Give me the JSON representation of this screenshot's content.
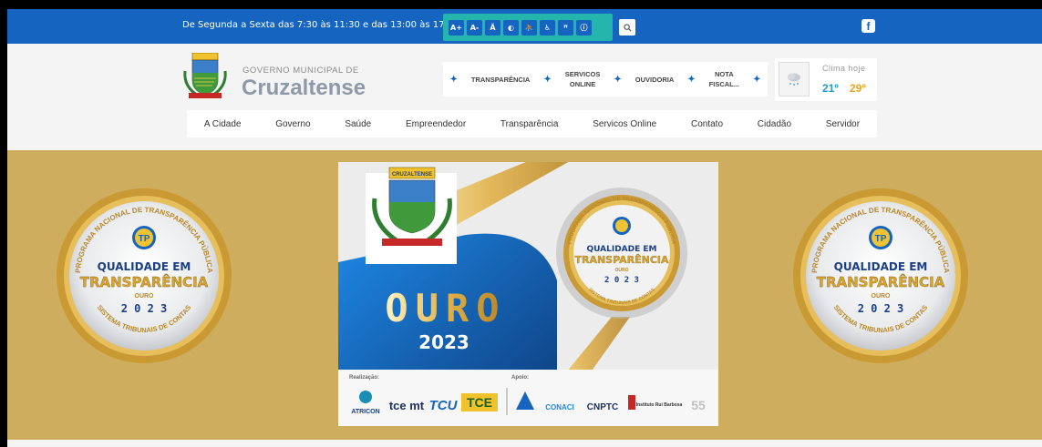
{
  "topbar": {
    "hours": "De Segunda a Sexta das 7:30 às 11:30 e das 13:00 às 17:00",
    "accessibility": [
      "A+",
      "A-",
      "Ă",
      "◐",
      "⛹",
      "♿",
      "ꟸ",
      "ⓘ"
    ],
    "search_icon": "search-icon",
    "social_icon": "facebook-icon",
    "social_label": "f"
  },
  "header": {
    "gov_label": "GOVERNO MUNICIPAL DE",
    "gov_name": "Cruzaltense",
    "crest_label": "CRUZALTENSE"
  },
  "quicknav": [
    {
      "label_1": "TRANSPARÊNCIA",
      "label_2": ""
    },
    {
      "label_1": "SERVICOS",
      "label_2": "ONLINE"
    },
    {
      "label_1": "OUVIDORIA",
      "label_2": ""
    },
    {
      "label_1": "NOTA",
      "label_2": "FISCAL..."
    }
  ],
  "weather": {
    "title": "Clima hoje",
    "min": "21º",
    "max": "29º"
  },
  "mainnav": [
    "A Cidade",
    "Governo",
    "Saúde",
    "Empreendedor",
    "Transparência",
    "Servicos Online",
    "Contato",
    "Cidadão",
    "Servidor"
  ],
  "banner": {
    "badge": {
      "arc_top": "PROGRAMA NACIONAL DE TRANSPARÊNCIA PÚBLICA",
      "line1": "QUALIDADE EM",
      "line2": "TRANSPARÊNCIA",
      "level": "OURO",
      "year": "2 0 2 3",
      "arc_bottom": "SISTEMA TRIBUNAIS DE CONTAS"
    },
    "card": {
      "crest_label": "CRUZALTENSE",
      "award": "OURO",
      "year": "2023",
      "realizacao": "Realização:",
      "apoio": "Apoio:",
      "partners": [
        "ATRICON",
        "tce mt",
        "TCU",
        "TCE",
        "CONACI",
        "CNPTC",
        "Instituto Rui Barbosa",
        "55"
      ]
    }
  },
  "colors": {
    "topbar": "#1565c0",
    "accessibility_bar": "#24b6ad",
    "banner": "#ceae5e",
    "gold": "#d4a73a"
  }
}
